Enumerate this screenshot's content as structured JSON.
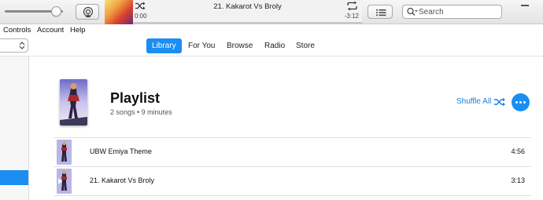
{
  "player": {
    "now_playing_title": "21. Kakarot Vs Broly",
    "elapsed": "0:00",
    "remaining": "-3:12",
    "progress": 0.0,
    "volume": 0.88
  },
  "search": {
    "placeholder": "Search"
  },
  "menu": [
    "Controls",
    "Account",
    "Help"
  ],
  "nav": {
    "tabs": [
      {
        "label": "Library",
        "active": true
      },
      {
        "label": "For You",
        "active": false
      },
      {
        "label": "Browse",
        "active": false
      },
      {
        "label": "Radio",
        "active": false
      },
      {
        "label": "Store",
        "active": false
      }
    ]
  },
  "playlist": {
    "title": "Playlist",
    "subtitle": "2 songs • 9 minutes",
    "shuffle_label": "Shuffle All"
  },
  "tracks": [
    {
      "title": "UBW Emiya Theme",
      "duration": "4:56"
    },
    {
      "title": "21. Kakarot Vs Broly",
      "duration": "3:13"
    }
  ],
  "colors": {
    "accent": "#1b8ef2",
    "accent_text": "#1b7fe3"
  }
}
